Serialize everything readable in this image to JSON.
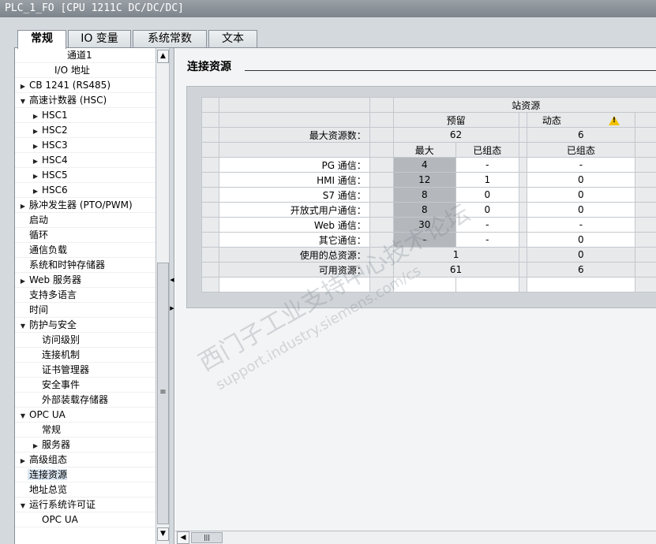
{
  "window": {
    "title": "PLC_1_FO [CPU 1211C DC/DC/DC]"
  },
  "tabs": [
    {
      "label": "常规"
    },
    {
      "label": "IO 变量"
    },
    {
      "label": "系统常数"
    },
    {
      "label": "文本"
    }
  ],
  "tree": [
    {
      "label": "通道1",
      "indent": 3,
      "arrow": ""
    },
    {
      "label": "I/O 地址",
      "indent": 2,
      "arrow": ""
    },
    {
      "label": "CB 1241 (RS485)",
      "indent": 0,
      "arrow": "right"
    },
    {
      "label": "高速计数器 (HSC)",
      "indent": 0,
      "arrow": "down"
    },
    {
      "label": "HSC1",
      "indent": 1,
      "arrow": "right"
    },
    {
      "label": "HSC2",
      "indent": 1,
      "arrow": "right"
    },
    {
      "label": "HSC3",
      "indent": 1,
      "arrow": "right"
    },
    {
      "label": "HSC4",
      "indent": 1,
      "arrow": "right"
    },
    {
      "label": "HSC5",
      "indent": 1,
      "arrow": "right"
    },
    {
      "label": "HSC6",
      "indent": 1,
      "arrow": "right"
    },
    {
      "label": "脉冲发生器 (PTO/PWM)",
      "indent": 0,
      "arrow": "right"
    },
    {
      "label": "启动",
      "indent": 0,
      "arrow": ""
    },
    {
      "label": "循环",
      "indent": 0,
      "arrow": ""
    },
    {
      "label": "通信负载",
      "indent": 0,
      "arrow": ""
    },
    {
      "label": "系统和时钟存储器",
      "indent": 0,
      "arrow": ""
    },
    {
      "label": "Web 服务器",
      "indent": 0,
      "arrow": "right"
    },
    {
      "label": "支持多语言",
      "indent": 0,
      "arrow": ""
    },
    {
      "label": "时间",
      "indent": 0,
      "arrow": ""
    },
    {
      "label": "防护与安全",
      "indent": 0,
      "arrow": "down"
    },
    {
      "label": "访问级别",
      "indent": 1,
      "arrow": ""
    },
    {
      "label": "连接机制",
      "indent": 1,
      "arrow": ""
    },
    {
      "label": "证书管理器",
      "indent": 1,
      "arrow": ""
    },
    {
      "label": "安全事件",
      "indent": 1,
      "arrow": ""
    },
    {
      "label": "外部装载存储器",
      "indent": 1,
      "arrow": ""
    },
    {
      "label": "OPC UA",
      "indent": 0,
      "arrow": "down"
    },
    {
      "label": "常规",
      "indent": 1,
      "arrow": ""
    },
    {
      "label": "服务器",
      "indent": 1,
      "arrow": "right"
    },
    {
      "label": "高级组态",
      "indent": 0,
      "arrow": "right"
    },
    {
      "label": "连接资源",
      "indent": 0,
      "arrow": "",
      "selected": true
    },
    {
      "label": "地址总览",
      "indent": 0,
      "arrow": ""
    },
    {
      "label": "运行系统许可证",
      "indent": 0,
      "arrow": "down"
    },
    {
      "label": "OPC UA",
      "indent": 1,
      "arrow": ""
    }
  ],
  "section": {
    "title": "连接资源"
  },
  "resources": {
    "header_station": "站资源",
    "header_reserved": "预留",
    "header_dynamic": "动态",
    "max_label": "最大资源数：",
    "max_reserved": "62",
    "max_dynamic": "6",
    "col_max": "最大",
    "col_configured": "已组态",
    "col_dyn_configured": "已组态",
    "rows": [
      {
        "label": "PG 通信：",
        "max": "4",
        "configured": "-",
        "dynamic": "-"
      },
      {
        "label": "HMI 通信：",
        "max": "12",
        "configured": "1",
        "dynamic": "0"
      },
      {
        "label": "S7 通信：",
        "max": "8",
        "configured": "0",
        "dynamic": "0"
      },
      {
        "label": "开放式用户通信：",
        "max": "8",
        "configured": "0",
        "dynamic": "0"
      },
      {
        "label": "Web 通信：",
        "max": "30",
        "configured": "-",
        "dynamic": "-"
      },
      {
        "label": "其它通信：",
        "max": "-",
        "configured": "-",
        "dynamic": "0"
      }
    ],
    "used_label": "使用的总资源：",
    "used_reserved": "1",
    "used_dynamic": "0",
    "avail_label": "可用资源：",
    "avail_reserved": "61",
    "avail_dynamic": "6"
  },
  "watermark": {
    "line1": "西门子工业支持中心技术论坛",
    "line2": "support.industry.siemens.com/cs"
  },
  "icons": {
    "warning": "warning-icon",
    "scroll_up": "chevron-up-icon",
    "scroll_down": "chevron-down-icon",
    "scroll_left": "chevron-left-icon"
  }
}
